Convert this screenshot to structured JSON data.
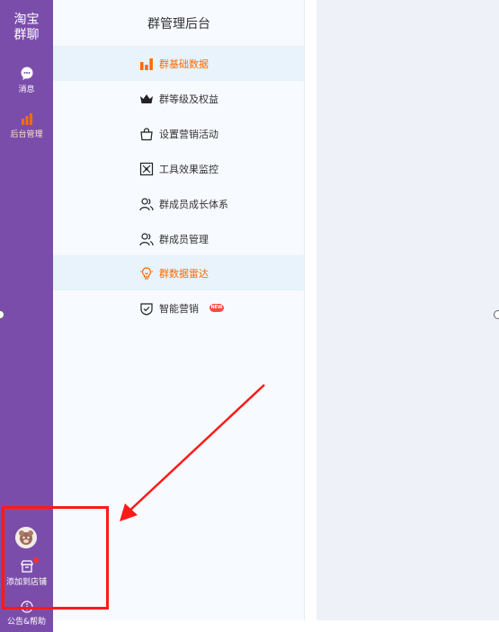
{
  "sidebar": {
    "brand_line1": "淘宝",
    "brand_line2": "群聊",
    "items": [
      {
        "label": "消息",
        "icon": "chat-bubble-icon"
      },
      {
        "label": "后台管理",
        "icon": "bar-chart-icon"
      }
    ],
    "bottom": {
      "avatar_icon": "avatar",
      "add_to_store_label": "添加到店铺",
      "help_label": "公告&帮助"
    }
  },
  "menu": {
    "title": "群管理后台",
    "items": [
      {
        "label": "群基础数据",
        "icon": "bar-chart-icon"
      },
      {
        "label": "群等级及权益",
        "icon": "crown-icon"
      },
      {
        "label": "设置营销活动",
        "icon": "shopping-bag-icon"
      },
      {
        "label": "工具效果监控",
        "icon": "monitor-icon"
      },
      {
        "label": "群成员成长体系",
        "icon": "users-icon"
      },
      {
        "label": "群成员管理",
        "icon": "users-icon"
      },
      {
        "label": "群数据雷达",
        "icon": "lightbulb-icon"
      },
      {
        "label": "智能营销",
        "icon": "shield-check-icon",
        "badge": "NEW"
      }
    ]
  },
  "colors": {
    "sidebar": "#7b4dab",
    "accent": "#ff6a00",
    "highlight": "#ff1a1a"
  }
}
